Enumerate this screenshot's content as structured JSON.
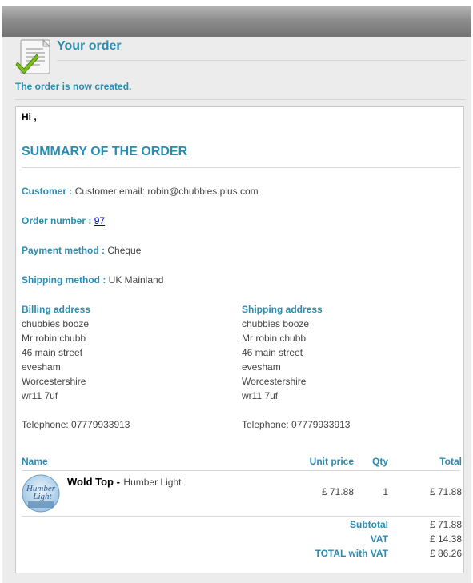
{
  "header": {
    "title": "Your order",
    "message": "The order is now created."
  },
  "summary": {
    "greeting": "Hi ,",
    "title": "SUMMARY OF THE ORDER",
    "customer_label": "Customer :",
    "customer_value": "Customer email: robin@chubbies.plus.com",
    "order_number_label": "Order number :",
    "order_number_value": "97",
    "payment_label": "Payment method :",
    "payment_value": "Cheque",
    "shipping_method_label": "Shipping method :",
    "shipping_method_value": "UK Mainland"
  },
  "billing": {
    "heading": "Billing address",
    "lines": [
      "chubbies booze",
      "Mr robin chubb",
      "46 main street",
      "evesham",
      "Worcestershire",
      "wr11 7uf"
    ],
    "telephone": "Telephone: 07779933913"
  },
  "shipping": {
    "heading": "Shipping address",
    "lines": [
      "chubbies booze",
      "Mr robin chubb",
      "46 main street",
      "evesham",
      "Worcestershire",
      "wr11 7uf"
    ],
    "telephone": "Telephone: 07779933913"
  },
  "items_table": {
    "headers": {
      "name": "Name",
      "unit_price": "Unit price",
      "qty": "Qty",
      "total": "Total"
    },
    "rows": [
      {
        "name": "Wold Top -",
        "variant": "Humber Light",
        "image_icon": "humber-light-logo",
        "unit_price": "£ 71.88",
        "qty": "1",
        "total": "£ 71.88"
      }
    ]
  },
  "totals": {
    "subtotal_label": "Subtotal",
    "subtotal_value": "£ 71.88",
    "vat_label": "VAT",
    "vat_value": "£ 14.38",
    "total_label": "TOTAL with VAT",
    "total_value": "£ 86.26"
  },
  "colors": {
    "accent": "#2a8cb0",
    "link": "#0000cc",
    "header_bar": "#8d8d8d",
    "panel_bg": "#ececec"
  }
}
